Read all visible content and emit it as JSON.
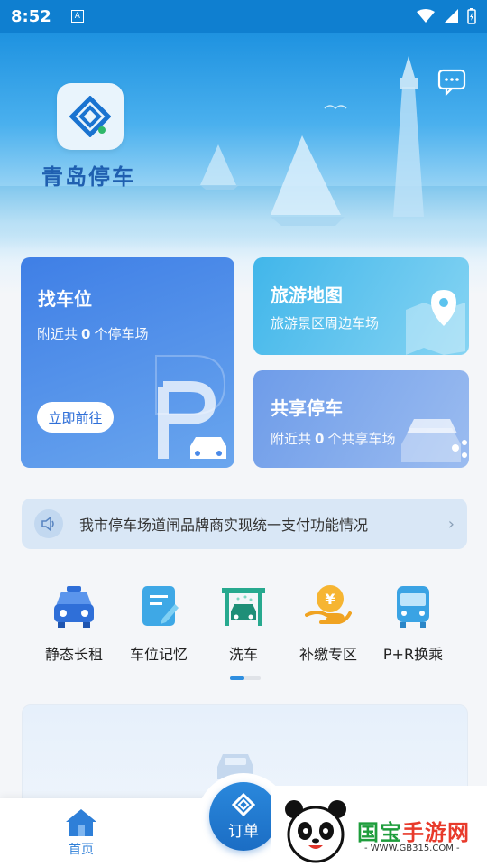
{
  "status_bar": {
    "time": "8:52",
    "notification": "A"
  },
  "app": {
    "name": "青岛停车"
  },
  "cards": {
    "find": {
      "title": "找车位",
      "sub_prefix": "附近共",
      "count": "0",
      "sub_suffix": "个停车场",
      "button": "立即前往"
    },
    "map": {
      "title": "旅游地图",
      "sub": "旅游景区周边车场"
    },
    "share": {
      "title": "共享停车",
      "sub_prefix": "附近共",
      "count": "0",
      "sub_suffix": "个共享车场"
    }
  },
  "notice": {
    "text": "我市停车场道闸品牌商实现统一支付功能情况"
  },
  "shortcuts": [
    {
      "label": "静态长租",
      "icon": "car-front-icon"
    },
    {
      "label": "车位记忆",
      "icon": "notepad-icon"
    },
    {
      "label": "洗车",
      "icon": "car-wash-icon"
    },
    {
      "label": "补缴专区",
      "icon": "yen-payment-icon"
    },
    {
      "label": "P+R换乘",
      "icon": "bus-icon"
    }
  ],
  "tabbar": {
    "home": "首页",
    "order": "订单"
  },
  "watermark": {
    "brand_green": "国宝",
    "brand_red": "手游网",
    "url": "- WWW.GB315.COM -"
  },
  "colors": {
    "primary": "#2e7fd8",
    "hero_top": "#1e92e0"
  }
}
